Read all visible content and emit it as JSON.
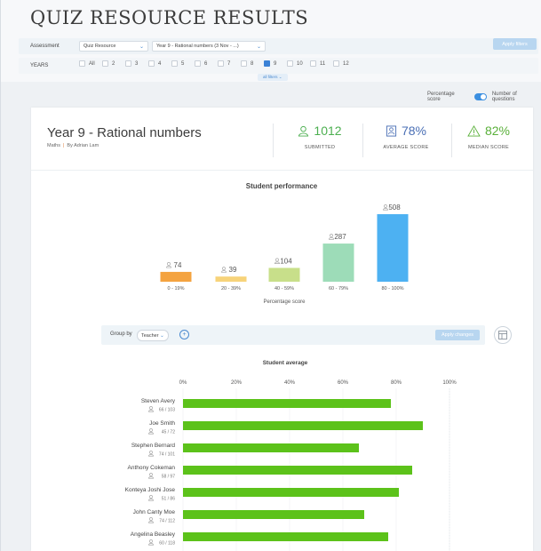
{
  "page": {
    "title": "QUIZ RESOURCE RESULTS"
  },
  "filters": {
    "assessment_label": "Assessment",
    "resource_select": "Quiz Resource",
    "quiz_select": "Year 9 - Rational numbers (3 Nov - ...)",
    "apply_label": "Apply filters",
    "years_label": "YEARS",
    "years": [
      {
        "label": "All",
        "checked": false
      },
      {
        "label": "2",
        "checked": false
      },
      {
        "label": "3",
        "checked": false
      },
      {
        "label": "4",
        "checked": false
      },
      {
        "label": "5",
        "checked": false
      },
      {
        "label": "6",
        "checked": false
      },
      {
        "label": "7",
        "checked": false
      },
      {
        "label": "8",
        "checked": false
      },
      {
        "label": "9",
        "checked": true
      },
      {
        "label": "10",
        "checked": false
      },
      {
        "label": "11",
        "checked": false
      },
      {
        "label": "12",
        "checked": false
      }
    ],
    "all_filters": "all filters"
  },
  "toggle": {
    "left": "Percentage score",
    "right": "Number of questions"
  },
  "header": {
    "title": "Year 9 - Rational numbers",
    "subject": "Maths",
    "author": "By Adrian Lam",
    "stats": [
      {
        "value": "1012",
        "label": "SUBMITTED",
        "color": "#4caf50",
        "icon": "user-icon"
      },
      {
        "value": "78%",
        "label": "AVERAGE SCORE",
        "color": "#4a6fb5",
        "icon": "score-icon"
      },
      {
        "value": "82%",
        "label": "MEDIAN SCORE",
        "color": "#5ab03a",
        "icon": "warning-icon"
      }
    ]
  },
  "group": {
    "label": "Group by",
    "value": "Teacher",
    "apply": "Apply changes"
  },
  "chart_data": [
    {
      "type": "bar",
      "title": "Student performance",
      "xlabel": "Percentage score",
      "categories": [
        "0 - 19%",
        "20 - 39%",
        "40 - 59%",
        "60 - 79%",
        "80 - 100%"
      ],
      "values": [
        74,
        39,
        104,
        287,
        508
      ],
      "colors": [
        "#f4a340",
        "#f7d37a",
        "#c8df8a",
        "#9ddcb8",
        "#4db1f2"
      ]
    },
    {
      "type": "bar",
      "orientation": "horizontal",
      "title": "Student average",
      "xlim": [
        0,
        100
      ],
      "ticks": [
        "0%",
        "20%",
        "40%",
        "60%",
        "80%",
        "100%"
      ],
      "categories": [
        "Steven Avery",
        "Joe Smith",
        "Stephen Bernard",
        "Anthony Cokeman",
        "Konteya Joshi Jose",
        "John Canty Moe",
        "Angelina Beasley"
      ],
      "subs": [
        "66 / 103",
        "45 / 72",
        "74 / 101",
        "58 / 97",
        "51 / 86",
        "74 / 112",
        "60 / 118"
      ],
      "values": [
        78,
        90,
        66,
        86,
        81,
        68,
        77
      ],
      "color": "#5cc21a"
    }
  ]
}
